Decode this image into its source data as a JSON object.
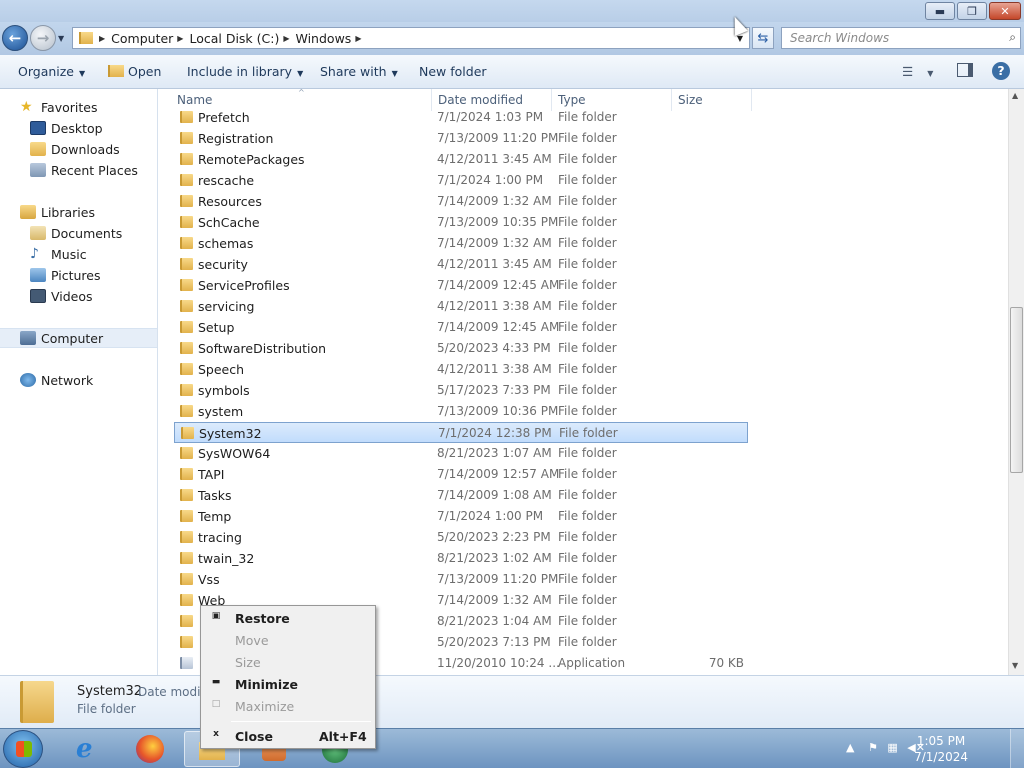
{
  "breadcrumb": [
    "Computer",
    "Local Disk (C:)",
    "Windows"
  ],
  "search": {
    "placeholder": "Search Windows"
  },
  "toolbar": {
    "organize": "Organize",
    "open": "Open",
    "include": "Include in library",
    "share": "Share with",
    "new_folder": "New folder"
  },
  "nav": {
    "favorites": "Favorites",
    "favorites_items": [
      "Desktop",
      "Downloads",
      "Recent Places"
    ],
    "libraries": "Libraries",
    "libraries_items": [
      "Documents",
      "Music",
      "Pictures",
      "Videos"
    ],
    "computer": "Computer",
    "network": "Network"
  },
  "columns": {
    "name": "Name",
    "date": "Date modified",
    "type": "Type",
    "size": "Size"
  },
  "files": [
    {
      "name": "Prefetch",
      "date": "7/1/2024 1:03 PM",
      "type": "File folder",
      "size": ""
    },
    {
      "name": "Registration",
      "date": "7/13/2009 11:20 PM",
      "type": "File folder",
      "size": ""
    },
    {
      "name": "RemotePackages",
      "date": "4/12/2011 3:45 AM",
      "type": "File folder",
      "size": ""
    },
    {
      "name": "rescache",
      "date": "7/1/2024 1:00 PM",
      "type": "File folder",
      "size": ""
    },
    {
      "name": "Resources",
      "date": "7/14/2009 1:32 AM",
      "type": "File folder",
      "size": ""
    },
    {
      "name": "SchCache",
      "date": "7/13/2009 10:35 PM",
      "type": "File folder",
      "size": ""
    },
    {
      "name": "schemas",
      "date": "7/14/2009 1:32 AM",
      "type": "File folder",
      "size": ""
    },
    {
      "name": "security",
      "date": "4/12/2011 3:45 AM",
      "type": "File folder",
      "size": ""
    },
    {
      "name": "ServiceProfiles",
      "date": "7/14/2009 12:45 AM",
      "type": "File folder",
      "size": ""
    },
    {
      "name": "servicing",
      "date": "4/12/2011 3:38 AM",
      "type": "File folder",
      "size": ""
    },
    {
      "name": "Setup",
      "date": "7/14/2009 12:45 AM",
      "type": "File folder",
      "size": ""
    },
    {
      "name": "SoftwareDistribution",
      "date": "5/20/2023 4:33 PM",
      "type": "File folder",
      "size": ""
    },
    {
      "name": "Speech",
      "date": "4/12/2011 3:38 AM",
      "type": "File folder",
      "size": ""
    },
    {
      "name": "symbols",
      "date": "5/17/2023 7:33 PM",
      "type": "File folder",
      "size": ""
    },
    {
      "name": "system",
      "date": "7/13/2009 10:36 PM",
      "type": "File folder",
      "size": ""
    },
    {
      "name": "System32",
      "date": "7/1/2024 12:38 PM",
      "type": "File folder",
      "size": "",
      "selected": true
    },
    {
      "name": "SysWOW64",
      "date": "8/21/2023 1:07 AM",
      "type": "File folder",
      "size": ""
    },
    {
      "name": "TAPI",
      "date": "7/14/2009 12:57 AM",
      "type": "File folder",
      "size": ""
    },
    {
      "name": "Tasks",
      "date": "7/14/2009 1:08 AM",
      "type": "File folder",
      "size": ""
    },
    {
      "name": "Temp",
      "date": "7/1/2024 1:00 PM",
      "type": "File folder",
      "size": ""
    },
    {
      "name": "tracing",
      "date": "5/20/2023 2:23 PM",
      "type": "File folder",
      "size": ""
    },
    {
      "name": "twain_32",
      "date": "8/21/2023 1:02 AM",
      "type": "File folder",
      "size": ""
    },
    {
      "name": "Vss",
      "date": "7/13/2009 11:20 PM",
      "type": "File folder",
      "size": ""
    },
    {
      "name": "Web",
      "date": "7/14/2009 1:32 AM",
      "type": "File folder",
      "size": ""
    },
    {
      "name": "",
      "date": "8/21/2023 1:04 AM",
      "type": "File folder",
      "size": ""
    },
    {
      "name": "",
      "date": "5/20/2023 7:13 PM",
      "type": "File folder",
      "size": ""
    },
    {
      "name": "",
      "date": "11/20/2010 10:24 ...",
      "type": "Application",
      "size": "70 KB"
    }
  ],
  "details": {
    "name": "System32",
    "date_label": "Date modifi",
    "type": "File folder"
  },
  "context_menu": [
    {
      "label": "Restore",
      "enabled": true,
      "glyph": "▣",
      "shortcut": ""
    },
    {
      "label": "Move",
      "enabled": false,
      "glyph": "",
      "shortcut": ""
    },
    {
      "label": "Size",
      "enabled": false,
      "glyph": "",
      "shortcut": ""
    },
    {
      "label": "Minimize",
      "enabled": true,
      "glyph": "▬",
      "shortcut": ""
    },
    {
      "label": "Maximize",
      "enabled": false,
      "glyph": "□",
      "shortcut": ""
    },
    {
      "label": "Close",
      "enabled": true,
      "glyph": "x",
      "shortcut": "Alt+F4"
    }
  ],
  "taskbar": {
    "time": "1:05 PM",
    "date": "7/1/2024"
  },
  "colors": {
    "accent": "#3a6ea5",
    "selection": "#cce4fc",
    "folder": "#e8bd5a"
  }
}
